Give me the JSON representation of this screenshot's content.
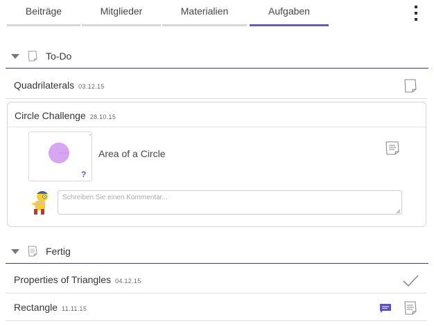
{
  "tabs": [
    {
      "label": "Beiträge",
      "active": false
    },
    {
      "label": "Mitglieder",
      "active": false
    },
    {
      "label": "Materialien",
      "active": false
    },
    {
      "label": "Aufgaben",
      "active": true
    }
  ],
  "menu_icon": "kebab-menu-icon",
  "accent_color": "#6557d2",
  "sections": {
    "todo": {
      "title": "To-Do",
      "icon": "blank-page-icon",
      "items": [
        {
          "title": "Quadrilaterals",
          "date": "03.12.15",
          "icon": "blank-page-icon"
        }
      ],
      "expanded": {
        "title": "Circle Challenge",
        "date": "28.10.15",
        "material": {
          "title": "Area of a Circle",
          "thumbnail": "purple-circle-thumbnail",
          "badge": "?"
        },
        "comment": {
          "placeholder": "Schreiben Sie einen Kommentar...",
          "value": ""
        }
      }
    },
    "done": {
      "title": "Fertig",
      "icon": "written-page-icon",
      "items": [
        {
          "title": "Properties of Triangles",
          "date": "04.12.15",
          "icon": "checkmark-icon"
        },
        {
          "title": "Rectangle",
          "date": "11.11.15",
          "icon": "written-page-icon",
          "extra_icon": "chat-bubble-icon"
        }
      ]
    }
  }
}
